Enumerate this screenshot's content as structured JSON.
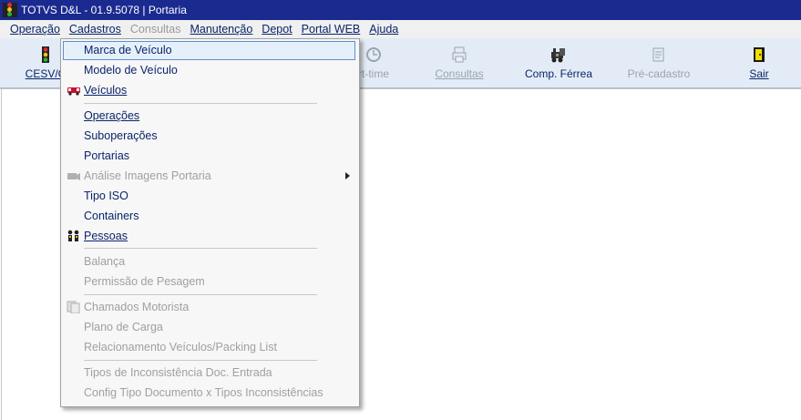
{
  "window": {
    "title": "TOTVS D&L - 01.9.5078 | Portaria"
  },
  "menubar": {
    "items": [
      {
        "label": "Operação",
        "disabled": false
      },
      {
        "label": "Cadastros",
        "disabled": false
      },
      {
        "label": "Consultas",
        "disabled": true
      },
      {
        "label": "Manutenção",
        "disabled": false
      },
      {
        "label": "Depot",
        "disabled": false
      },
      {
        "label": "Portal WEB",
        "disabled": false
      },
      {
        "label": "Ajuda",
        "disabled": false
      }
    ]
  },
  "toolbar": {
    "cesv": "CESV/C",
    "turntime": "rt-time",
    "consultas": "Consultas",
    "comp_ferrea": "Comp. Férrea",
    "pre_cadastro": "Pré-cadastro",
    "sair": "Sair"
  },
  "cadastros_menu": {
    "items": [
      {
        "label": "Marca de Veículo",
        "disabled": false,
        "selected": true
      },
      {
        "label": "Modelo de Veículo",
        "disabled": false
      },
      {
        "label": "Veículos",
        "disabled": false,
        "icon": "truck-icon"
      },
      {
        "label": "Operações",
        "disabled": false
      },
      {
        "label": "Suboperações",
        "disabled": false
      },
      {
        "label": "Portarias",
        "disabled": false
      },
      {
        "label": "Análise Imagens Portaria",
        "disabled": true,
        "icon": "camera-icon",
        "submenu": true
      },
      {
        "label": "Tipo ISO",
        "disabled": false
      },
      {
        "label": "Containers",
        "disabled": false
      },
      {
        "label": "Pessoas",
        "disabled": false,
        "icon": "people-icon"
      },
      {
        "label": "Balança",
        "disabled": true
      },
      {
        "label": "Permissão de Pesagem",
        "disabled": true
      },
      {
        "label": "Chamados Motorista",
        "disabled": true,
        "icon": "documents-icon"
      },
      {
        "label": "Plano de Carga",
        "disabled": true
      },
      {
        "label": "Relacionamento Veículos/Packing List",
        "disabled": true
      },
      {
        "label": "Tipos de Inconsistência Doc. Entrada",
        "disabled": true
      },
      {
        "label": "Config Tipo Documento x Tipos Inconsistências",
        "disabled": true
      }
    ]
  }
}
